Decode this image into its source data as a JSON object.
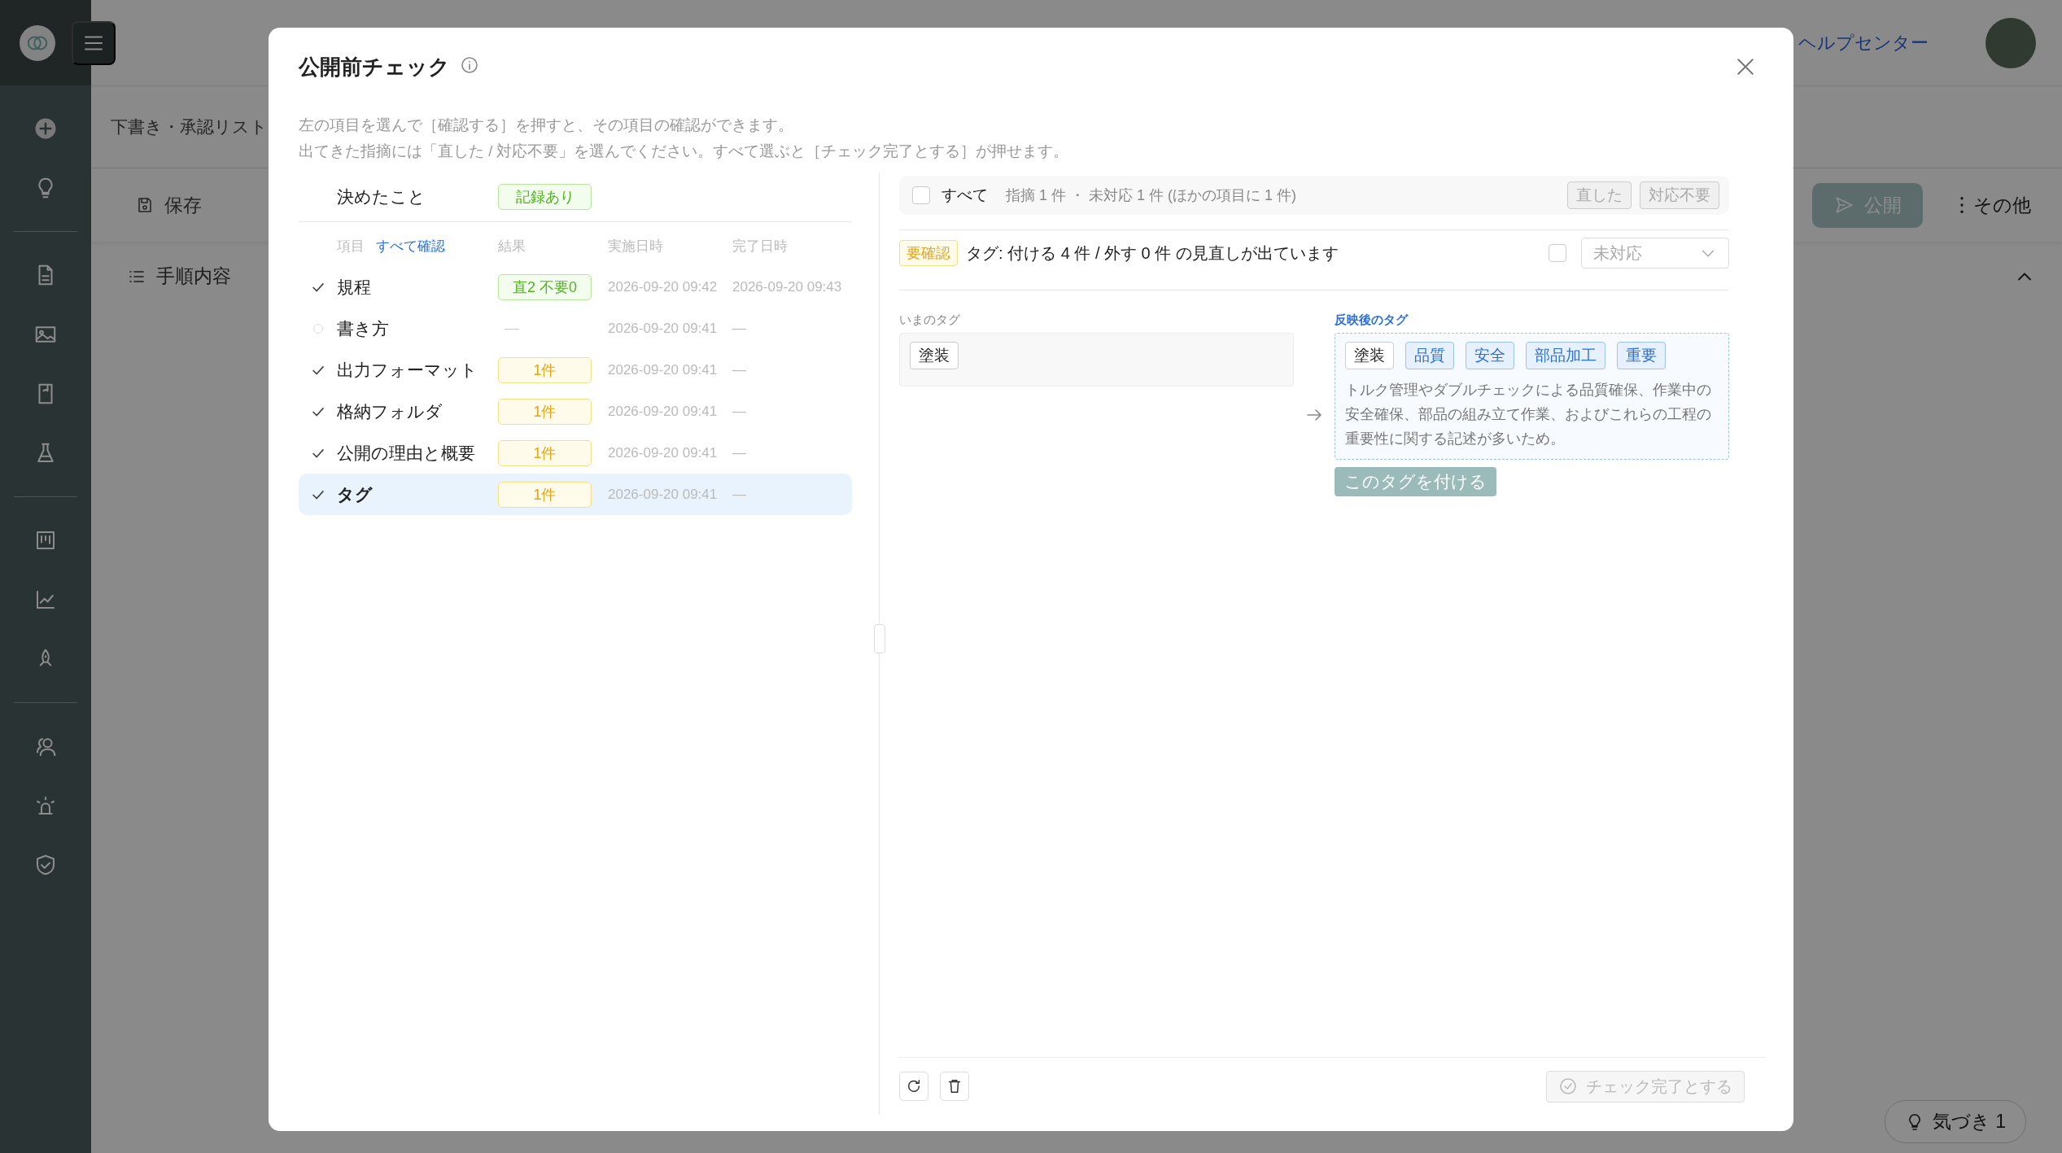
{
  "app": {
    "breadcrumb": "下書き・承認リスト",
    "help_link": "ヘルプセンター",
    "toolbar": {
      "save": "保存",
      "publish": "公開",
      "more": "その他"
    },
    "tab": "手順内容",
    "insight_button": "気づき 1"
  },
  "dialog": {
    "title": "公開前チェック",
    "description": [
      "左の項目を選んで［確認する］を押すと、その項目の確認ができます。",
      "出てきた指摘には「直した / 対応不要」を選んでください。すべて選ぶと［チェック完了とする］が押せます。"
    ],
    "decision": {
      "label": "決めたこと",
      "badge": "記録あり"
    },
    "columns": {
      "item": "項目",
      "confirm_all": "すべて確認",
      "result": "結果",
      "started": "実施日時",
      "finished": "完了日時"
    },
    "items": [
      {
        "name": "規程",
        "checked": true,
        "selected": false,
        "kind": "ok",
        "result": "直2 不要0",
        "started": "2026-09-20 09:42",
        "finished": "2026-09-20 09:43"
      },
      {
        "name": "書き方",
        "checked": false,
        "selected": false,
        "kind": "none",
        "result": "—",
        "started": "2026-09-20 09:41",
        "finished": "—"
      },
      {
        "name": "出力フォーマット",
        "checked": true,
        "selected": false,
        "kind": "count",
        "result": "1件",
        "started": "2026-09-20 09:41",
        "finished": "—"
      },
      {
        "name": "格納フォルダ",
        "checked": true,
        "selected": false,
        "kind": "count",
        "result": "1件",
        "started": "2026-09-20 09:41",
        "finished": "—"
      },
      {
        "name": "公開の理由と概要",
        "checked": true,
        "selected": false,
        "kind": "count",
        "result": "1件",
        "started": "2026-09-20 09:41",
        "finished": "—"
      },
      {
        "name": "タグ",
        "checked": true,
        "selected": true,
        "kind": "count",
        "result": "1件",
        "started": "2026-09-20 09:41",
        "finished": "—"
      }
    ],
    "bulk": {
      "label": "すべて",
      "checked": false,
      "summary": "指摘 1 件 ・ 未対応 1 件 (ほかの項目に 1 件)",
      "buttons": [
        {
          "label": "直した",
          "disabled": true
        },
        {
          "label": "対応不要",
          "disabled": true
        }
      ]
    },
    "finding": {
      "badge": "要確認",
      "message": "タグ: 付ける 4 件 / 外す 0 件 の見直しが出ています",
      "checked": false,
      "status": "未対応"
    },
    "current_tags": {
      "label": "いまのタグ",
      "tags": [
        {
          "label": "塗装",
          "added": false
        }
      ]
    },
    "new_tags": {
      "label": "反映後のタグ",
      "tags": [
        {
          "label": "塗装",
          "added": false
        },
        {
          "label": "品質",
          "added": true
        },
        {
          "label": "安全",
          "added": true
        },
        {
          "label": "部品加工",
          "added": true
        },
        {
          "label": "重要",
          "added": true
        }
      ],
      "reason": "トルク管理やダブルチェックによる品質確保、作業中の安全確保、部品の組み立て作業、およびこれらの工程の重要性に関する記述が多いため。",
      "apply_button": "このタグを付ける"
    },
    "complete_button": {
      "label": "チェック完了とする",
      "disabled": true
    }
  }
}
